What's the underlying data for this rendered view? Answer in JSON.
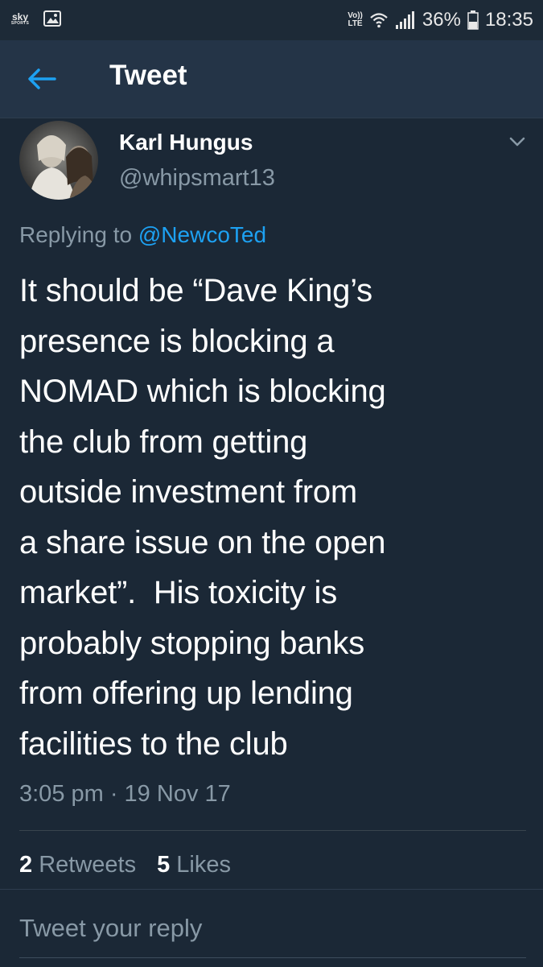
{
  "status_bar": {
    "sky_top": "sky",
    "sky_bottom": "SPORTS",
    "volte_top": "Vo))",
    "volte_bottom": "LTE",
    "battery": "36%",
    "time": "18:35",
    "icons": [
      "sky-sports-icon",
      "gallery-icon",
      "wifi-icon",
      "signal-icon",
      "battery-icon"
    ]
  },
  "header": {
    "title": "Tweet",
    "back_icon": "arrow-left-icon"
  },
  "tweet": {
    "author_name": "Karl Hungus",
    "author_handle": "@whipsmart13",
    "replying_prefix": "Replying to ",
    "replying_to": "@NewcoTed",
    "text": "It should be “Dave King’s\npresence is blocking a\nNOMAD which is blocking\nthe club from getting\noutside investment from\na share issue on the open\nmarket”.  His toxicity is\nprobably stopping banks\nfrom offering up lending\nfacilities to the club",
    "timestamp": "3:05 pm · 19 Nov 17",
    "retweets_count": "2",
    "retweets_label": "Retweets",
    "likes_count": "5",
    "likes_label": "Likes"
  },
  "reply": {
    "placeholder": "Tweet your reply"
  },
  "colors": {
    "background": "#1b2836",
    "header_bg": "#243447",
    "accent": "#1da1f2",
    "secondary_text": "#8899a6"
  }
}
